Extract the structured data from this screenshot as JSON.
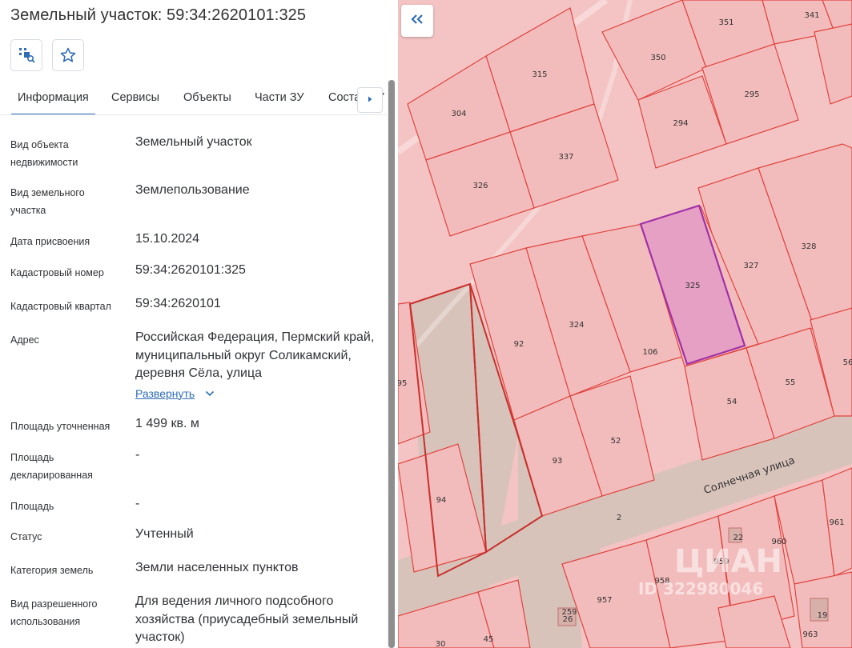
{
  "title": "Земельный участок: 59:34:2620101:325",
  "tabs": [
    {
      "label": "Информация"
    },
    {
      "label": "Сервисы"
    },
    {
      "label": "Объекты"
    },
    {
      "label": "Части ЗУ"
    },
    {
      "label": "Состав ЗУ"
    }
  ],
  "info": [
    {
      "label": "Вид объекта недвижимости",
      "value": "Земельный участок"
    },
    {
      "label": "Вид земельного участка",
      "value": "Землепользование"
    },
    {
      "label": "Дата присвоения",
      "value": "15.10.2024"
    },
    {
      "label": "Кадастровый номер",
      "value": "59:34:2620101:325"
    },
    {
      "label": "Кадастровый квартал",
      "value": "59:34:2620101"
    },
    {
      "label": "Адрес",
      "value": "Российская Федерация, Пермский край, муниципальный округ Соликамский, деревня Сёла, улица"
    },
    {
      "label": "Площадь уточненная",
      "value": "1 499 кв. м"
    },
    {
      "label": "Площадь декларированная",
      "value": "-"
    },
    {
      "label": "Площадь",
      "value": "-"
    },
    {
      "label": "Статус",
      "value": "Учтенный"
    },
    {
      "label": "Категория земель",
      "value": "Земли населенных пунктов"
    },
    {
      "label": "Вид разрешенного использования",
      "value": "Для ведения личного подсобного хозяйства (приусадебный земельный участок)"
    }
  ],
  "expand_label": "Развернуть",
  "map": {
    "street_label": "Солнечная улица",
    "watermark": "ЦИАН",
    "watermark_id": "ID 322980046",
    "parcel_labels": [
      "341",
      "351",
      "350",
      "315",
      "295",
      "304",
      "294",
      "337",
      "326",
      "328",
      "327",
      "325",
      "324",
      "92",
      "106",
      "95",
      "55",
      "54",
      "93",
      "52",
      "56",
      "94",
      "2",
      "22",
      "961",
      "960",
      "959",
      "958",
      "957",
      "259",
      "26",
      "19",
      "963",
      "30",
      "45"
    ],
    "colors": {
      "parcel_fill": "#f4c4c4",
      "parcel_stroke": "#e0443f",
      "selected_fill": "#e6a0c4",
      "selected_stroke": "#a030a8",
      "road_fill": "#d8c3bb"
    }
  },
  "icons": {
    "select_area": "select-area-icon",
    "favorite": "star-icon",
    "tab_next": "chevron-right-icon",
    "map_collapse": "double-chevron-left-icon",
    "expand": "chevron-down-icon"
  }
}
